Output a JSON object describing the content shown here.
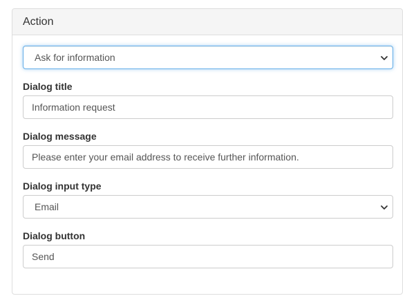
{
  "panel": {
    "title": "Action"
  },
  "action_select": {
    "value": "Ask for information"
  },
  "fields": {
    "dialog_title": {
      "label": "Dialog title",
      "value": "Information request"
    },
    "dialog_message": {
      "label": "Dialog message",
      "value": "Please enter your email address to receive further information."
    },
    "dialog_input_type": {
      "label": "Dialog input type",
      "value": "Email"
    },
    "dialog_button": {
      "label": "Dialog button",
      "value": "Send"
    }
  },
  "icons": {
    "select_arrow": "chevron-down-icon"
  },
  "colors": {
    "focus_border": "#66afe9",
    "heading_bg": "#f5f5f5",
    "border": "#cccccc"
  }
}
